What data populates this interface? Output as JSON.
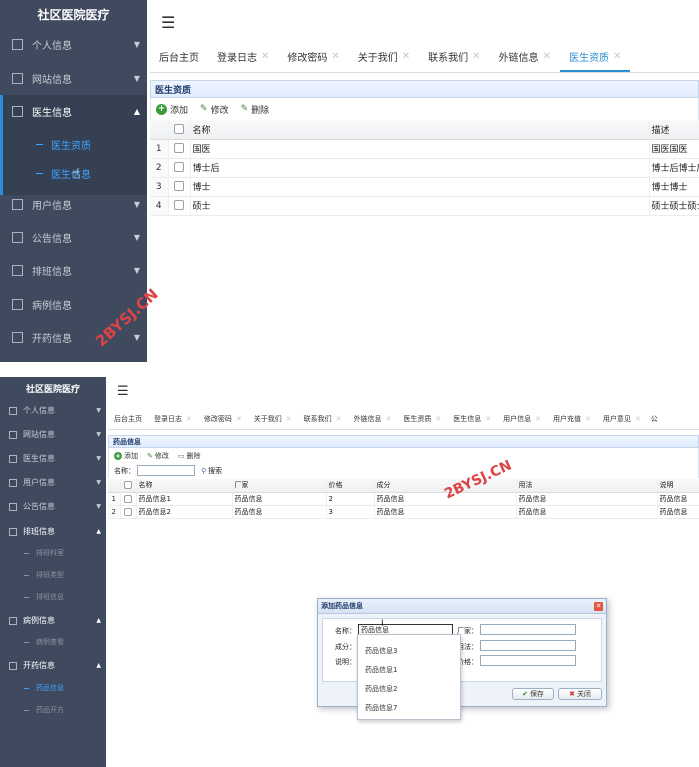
{
  "top": {
    "app_title": "社区医院医疗",
    "sidebar": [
      {
        "label": "个人信息",
        "arrow": "▼"
      },
      {
        "label": "网站信息",
        "arrow": "▼"
      },
      {
        "label": "医生信息",
        "arrow": "▲"
      },
      {
        "label": "用户信息",
        "arrow": "▼"
      },
      {
        "label": "公告信息",
        "arrow": "▼"
      },
      {
        "label": "排班信息",
        "arrow": "▼"
      },
      {
        "label": "病例信息",
        "arrow": ""
      },
      {
        "label": "开药信息",
        "arrow": "▼"
      }
    ],
    "submenu": [
      "医生资质",
      "医生信息"
    ],
    "tabs": [
      "后台主页",
      "登录日志",
      "修改密码",
      "关于我们",
      "联系我们",
      "外链信息",
      "医生资质"
    ],
    "panel_title": "医生资质",
    "toolbar": {
      "add": "添加",
      "edit": "修改",
      "delete": "删除"
    },
    "columns": [
      "名称",
      "描述"
    ],
    "rows": [
      {
        "n": "1",
        "name": "国医",
        "desc": "国医国医"
      },
      {
        "n": "2",
        "name": "博士后",
        "desc": "博士后博士后"
      },
      {
        "n": "3",
        "name": "博士",
        "desc": "博士博士"
      },
      {
        "n": "4",
        "name": "硕士",
        "desc": "硕士硕士硕士"
      }
    ]
  },
  "bottom": {
    "app_title": "社区医院医疗",
    "sidebar": [
      {
        "label": "个人信息",
        "arrow": "▼"
      },
      {
        "label": "网站信息",
        "arrow": "▼"
      },
      {
        "label": "医生信息",
        "arrow": "▼"
      },
      {
        "label": "用户信息",
        "arrow": "▼"
      },
      {
        "label": "公告信息",
        "arrow": "▼"
      },
      {
        "label": "排班信息",
        "arrow": "▲"
      },
      {
        "label": "病例信息",
        "arrow": "▲"
      },
      {
        "label": "开药信息",
        "arrow": "▲"
      }
    ],
    "sub_paiban": [
      "排班科室",
      "排班类型",
      "排班信息"
    ],
    "sub_bingli": [
      "病例查看"
    ],
    "sub_kaiyao": [
      "药品信息",
      "药品开方"
    ],
    "tabs": [
      "后台主页",
      "登录日志",
      "修改密码",
      "关于我们",
      "联系我们",
      "外链信息",
      "医生资质",
      "医生信息",
      "用户信息",
      "用户充值",
      "用户意见",
      "公"
    ],
    "panel_title": "药品信息",
    "toolbar": {
      "add": "添加",
      "edit": "修改",
      "delete": "删除"
    },
    "search_label": "名称：",
    "search_button": "搜索",
    "columns": [
      "名称",
      "厂家",
      "价格",
      "成分",
      "用法",
      "说明"
    ],
    "rows": [
      {
        "n": "1",
        "name": "药品信息1",
        "factory": "药品信息",
        "price": "2",
        "comp": "药品信息",
        "usage": "药品信息",
        "note": "药品信息"
      },
      {
        "n": "2",
        "name": "药品信息2",
        "factory": "药品信息",
        "price": "3",
        "comp": "药品信息",
        "usage": "药品信息",
        "note": "药品信息"
      }
    ],
    "dialog": {
      "title": "添加药品信息",
      "label_name": "名称：",
      "label_factory": "厂家：",
      "label_comp": "成分：",
      "label_usage": "用法：",
      "label_note": "说明：",
      "label_price": "价格：",
      "name_value": "药品信息",
      "dropdown": [
        "药品信息3",
        "药品信息1",
        "药品信息2",
        "药品信息7"
      ],
      "save": "保存",
      "close": "关闭"
    }
  },
  "watermark": "2BYSJ.CN"
}
